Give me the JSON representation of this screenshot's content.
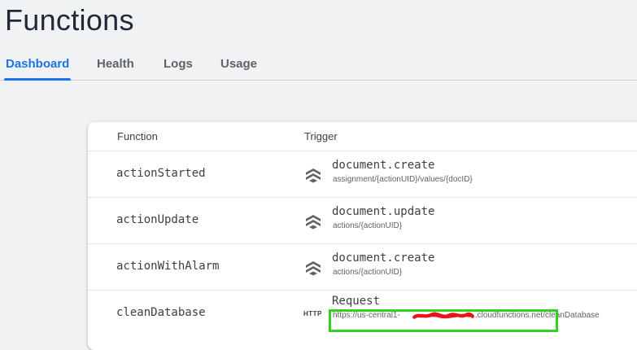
{
  "page": {
    "title": "Functions"
  },
  "tabs": [
    {
      "label": "Dashboard",
      "active": true
    },
    {
      "label": "Health",
      "active": false
    },
    {
      "label": "Logs",
      "active": false
    },
    {
      "label": "Usage",
      "active": false
    }
  ],
  "table": {
    "headers": {
      "function": "Function",
      "trigger": "Trigger"
    },
    "rows": [
      {
        "name": "actionStarted",
        "trigger_type": "firestore",
        "trigger_main": "document.create",
        "trigger_sub": "assignment/{actionUID}/values/{docID}"
      },
      {
        "name": "actionUpdate",
        "trigger_type": "firestore",
        "trigger_main": "document.update",
        "trigger_sub": "actions/{actionUID}"
      },
      {
        "name": "actionWithAlarm",
        "trigger_type": "firestore",
        "trigger_main": "document.create",
        "trigger_sub": "actions/{actionUID}"
      },
      {
        "name": "cleanDatabase",
        "trigger_type": "http",
        "http_label": "HTTP",
        "trigger_main": "Request",
        "trigger_sub": "https://us-central1-",
        "trigger_sub_suffix": ".cloudfunctions.net/cleanDatabase"
      }
    ]
  },
  "colors": {
    "accent": "#1a73e8",
    "annotation_box": "#33d11f",
    "redaction": "#e8141b"
  }
}
